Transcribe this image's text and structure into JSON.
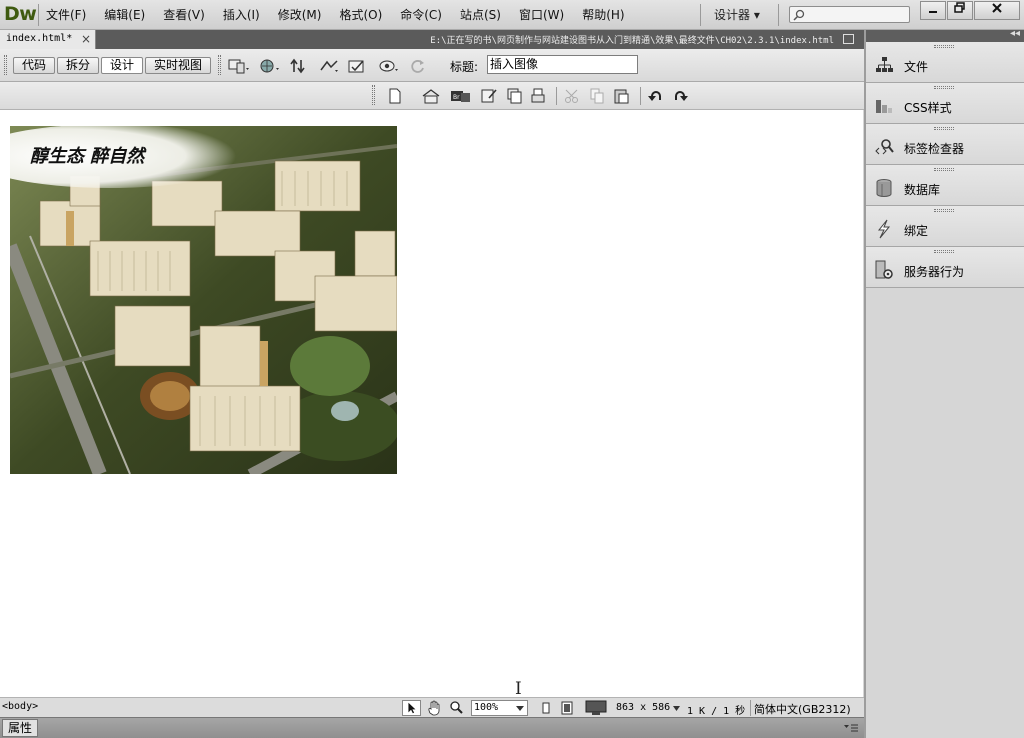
{
  "app": {
    "logo": "Dw",
    "menu": [
      "文件(F)",
      "编辑(E)",
      "查看(V)",
      "插入(I)",
      "修改(M)",
      "格式(O)",
      "命令(C)",
      "站点(S)",
      "窗口(W)",
      "帮助(H)"
    ],
    "workspace_label": "设计器 ▾"
  },
  "document": {
    "tab_label": "index.html*",
    "close_glyph": "×",
    "path": "E:\\正在写的书\\网页制作与网站建设图书从入门到精通\\效果\\最终文件\\CH02\\2.3.1\\index.html"
  },
  "doc_toolbar": {
    "views": [
      "代码",
      "拆分",
      "设计",
      "实时视图"
    ],
    "active_view": "设计",
    "title_label": "标题:",
    "title_value": "插入图像"
  },
  "design_view": {
    "image_caption": "醇生态  醉自然"
  },
  "status_bar": {
    "tag": "<body>",
    "zoom": "100%",
    "dimensions": "863 x 586",
    "size": "1 K / 1 秒",
    "encoding": "简体中文(GB2312)"
  },
  "properties": {
    "tab_label": "属性"
  },
  "panels": [
    {
      "label": "文件",
      "icon": "files-icon"
    },
    {
      "label": "CSS样式",
      "icon": "css-styles-icon"
    },
    {
      "label": "标签检查器",
      "icon": "tag-inspector-icon"
    },
    {
      "label": "数据库",
      "icon": "database-icon"
    },
    {
      "label": "绑定",
      "icon": "bindings-icon"
    },
    {
      "label": "服务器行为",
      "icon": "server-behaviors-icon"
    }
  ],
  "colors": {
    "logo": "#3f5a10",
    "tab_bar": "#5b5b5b",
    "design_bg": "#ffffff"
  }
}
